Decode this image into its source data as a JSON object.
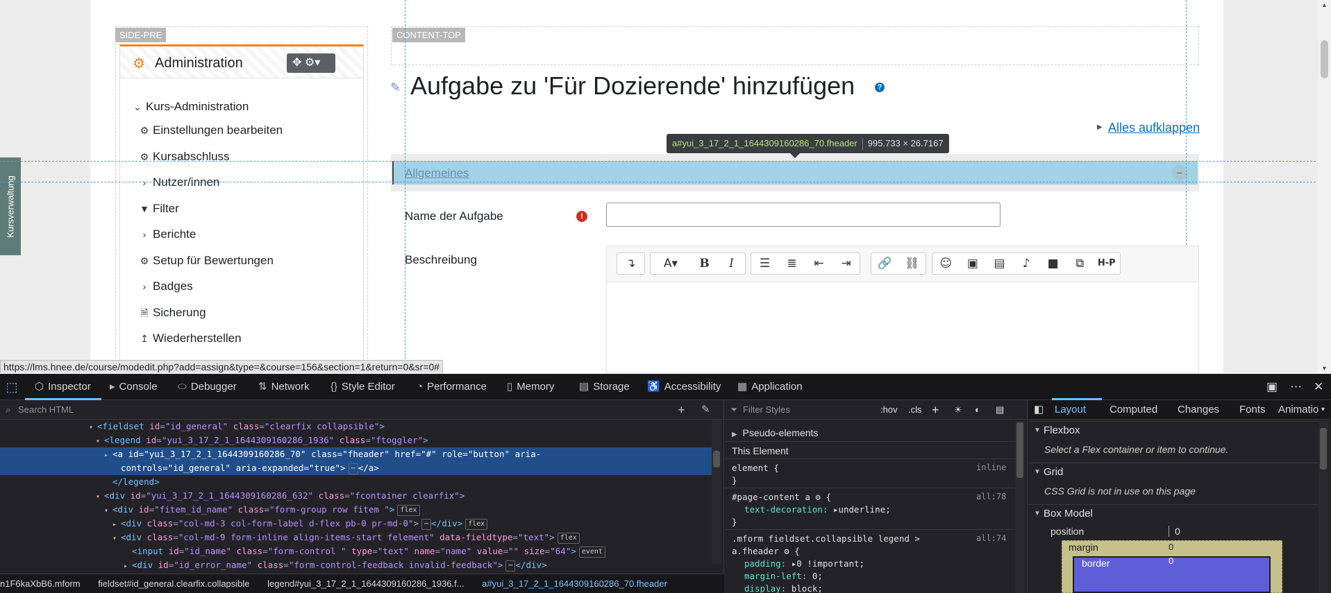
{
  "page": {
    "side_pre_label": "SIDE-PRE",
    "content_top_label": "CONTENT-TOP",
    "sidebar_tab": "Kursverwaltung",
    "block_title": "Administration",
    "nav": [
      {
        "label": "Kurs-Administration",
        "icon": "chevron-down-icon"
      },
      {
        "label": "Einstellungen bearbeiten",
        "icon": "gear-icon"
      },
      {
        "label": "Kursabschluss",
        "icon": "gear-icon"
      },
      {
        "label": "Nutzer/innen",
        "icon": "chevron-right-icon"
      },
      {
        "label": "Filter",
        "icon": "filter-icon"
      },
      {
        "label": "Berichte",
        "icon": "chevron-right-icon"
      },
      {
        "label": "Setup für Bewertungen",
        "icon": "gear-icon"
      },
      {
        "label": "Badges",
        "icon": "chevron-right-icon"
      },
      {
        "label": "Sicherung",
        "icon": "file-icon"
      },
      {
        "label": "Wiederherstellen",
        "icon": "upload-icon"
      }
    ],
    "title": "Aufgabe zu 'Für Dozierende' hinzufügen",
    "expand_all": "Alles aufklappen",
    "legend": "Allgemeines",
    "field_name_label": "Name der Aufgabe",
    "field_name_value": "",
    "field_desc_label": "Beschreibung",
    "tooltip_selector": "a#yui_3_17_2_1_1644309160286_70.fheader",
    "tooltip_size": "995.733 × 26.7167",
    "status_url": "https://lms.hnee.de/course/modedit.php?add=assign&type=&course=156&section=1&return=0&sr=0#"
  },
  "editor_toolbar": {
    "icons": [
      "collapse-icon",
      "font-size-icon",
      "bold-icon",
      "italic-icon",
      "bullet-list-icon",
      "numbered-list-icon",
      "outdent-icon",
      "indent-icon",
      "link-icon",
      "unlink-icon",
      "emoji-icon",
      "image-icon",
      "media-icon",
      "record-audio-icon",
      "record-video-icon",
      "manage-files-icon",
      "h5p-icon"
    ],
    "bold": "B",
    "italic": "I",
    "h5p": "H-P"
  },
  "devtools": {
    "tabs": [
      "Inspector",
      "Console",
      "Debugger",
      "Network",
      "Style Editor",
      "Performance",
      "Memory",
      "Storage",
      "Accessibility",
      "Application"
    ],
    "search_placeholder": "Search HTML",
    "filter_placeholder": "Filter Styles",
    "hov": ":hov",
    ".cls": ".cls",
    "html_lines": [
      {
        "indent": 140,
        "tw": "▾",
        "html": "<span class='tag'>&lt;fieldset</span> <span class='attr'>id</span>=<span class='val'>\"id_general\"</span> <span class='attr'>class</span>=<span class='val'>\"clearfix collapsible\"</span><span class='tag'>&gt;</span>"
      },
      {
        "indent": 150,
        "tw": "▾",
        "html": "<span class='tag'>&lt;legend</span> <span class='attr'>id</span>=<span class='val'>\"yui_3_17_2_1_1644309160286_1936\"</span> <span class='attr'>class</span>=<span class='val'>\"ftoggler\"</span><span class='tag'>&gt;</span>"
      },
      {
        "indent": 162,
        "tw": "▸",
        "sel": true,
        "html": "<span class='tag'>&lt;a</span> <span class='attr'>id</span>=<span class='val'>\"yui_3_17_2_1_1644309160286_70\"</span> <span class='attr'>class</span>=<span class='val'>\"fheader\"</span> <span class='attr'>href</span>=<span class='val'>\"#\"</span> <span class='attr'>role</span>=<span class='val'>\"button\"</span> <span class='attr'>aria-</span>"
      },
      {
        "indent": 174,
        "tw": "",
        "sel": true,
        "html": "<span class='attr'>controls</span>=<span class='val'>\"id_general\"</span> <span class='attr'>aria-expanded</span>=<span class='val'>\"true\"</span><span class='tag'>&gt;</span><span class='badge'>⋯</span><span class='tag'>&lt;/a&gt;</span>"
      },
      {
        "indent": 162,
        "tw": "",
        "html": "<span class='tag'>&lt;/legend&gt;</span>"
      },
      {
        "indent": 150,
        "tw": "▾",
        "html": "<span class='tag'>&lt;div</span> <span class='attr'>id</span>=<span class='val'>\"yui_3_17_2_1_1644309160286_632\"</span> <span class='attr'>class</span>=<span class='val'>\"fcontainer clearfix\"</span><span class='tag'>&gt;</span>"
      },
      {
        "indent": 162,
        "tw": "▾",
        "html": "<span class='tag'>&lt;div</span> <span class='attr'>id</span>=<span class='val'>\"fitem_id_name\"</span> <span class='attr'>class</span>=<span class='val'>\"form-group row fitem \"</span><span class='tag'>&gt;</span><span class='badge'>flex</span>"
      },
      {
        "indent": 174,
        "tw": "▸",
        "html": "<span class='tag'>&lt;div</span> <span class='attr'>class</span>=<span class='val'>\"col-md-3 col-form-label d-flex pb-0 pr-md-0\"</span><span class='tag'>&gt;</span><span class='badge'>⋯</span><span class='tag'>&lt;/div&gt;</span><span class='badge'>flex</span>"
      },
      {
        "indent": 174,
        "tw": "▾",
        "html": "<span class='tag'>&lt;div</span> <span class='attr'>class</span>=<span class='val'>\"col-md-9 form-inline align-items-start felement\"</span> <span class='attr'>data-fieldtype</span>=<span class='val'>\"text\"</span><span class='tag'>&gt;</span><span class='badge'>flex</span>"
      },
      {
        "indent": 190,
        "tw": "",
        "html": "<span class='tag'>&lt;input</span> <span class='attr'>id</span>=<span class='val'>\"id_name\"</span> <span class='attr'>class</span>=<span class='val'>\"form-control \"</span> <span class='attr'>type</span>=<span class='val'>\"text\"</span> <span class='attr'>name</span>=<span class='val'>\"name\"</span> <span class='attr'>value</span>=<span class='val'>\"\"</span> <span class='attr'>size</span>=<span class='val'>\"64\"</span><span class='tag'>&gt;</span><span class='badge'>event</span>"
      },
      {
        "indent": 190,
        "tw": "▸",
        "html": "<span class='tag'>&lt;div</span> <span class='attr'>id</span>=<span class='val'>\"id_error_name\"</span> <span class='attr'>class</span>=<span class='val'>\"form-control-feedback invalid-feedback\"</span><span class='tag'>&gt;</span><span class='badge'>⋯</span><span class='tag'>&lt;/div&gt;</span>"
      }
    ],
    "breadcrumbs": [
      "n1F6kaXbB6.mform",
      "fieldset#id_general.clearfix.collapsible",
      "legend#yui_3_17_2_1_1644309160286_1936.f...",
      "a#yui_3_17_2_1_1644309160286_70.fheader"
    ],
    "rules": {
      "pseudo": "Pseudo-elements",
      "this_element": "This Element",
      "element_open": "element {",
      "element_src": "inline",
      "close": "}",
      "r1_sel": "#page-content a",
      "r1_src": "all:78",
      "r1_prop": "text-decoration:",
      "r1_val": "underline;",
      "r2_sel1": ".mform fieldset.collapsible legend >",
      "r2_sel2": "a.fheader",
      "r2_src": "all:74",
      "r2_p1": "padding:",
      "r2_v1": "0 !important;",
      "r2_p2": "margin-left:",
      "r2_v2": "0;",
      "r2_p3": "display:",
      "r2_v3": "block;"
    },
    "layout_tabs": [
      "Layout",
      "Computed",
      "Changes",
      "Fonts",
      "Animatio"
    ],
    "flexbox": "Flexbox",
    "flexbox_note": "Select a Flex container or item to continue.",
    "grid": "Grid",
    "grid_note": "CSS Grid is not in use on this page",
    "box_model": "Box Model",
    "position_label": "position",
    "position_val": "0",
    "margin_label": "margin",
    "margin_val": "0",
    "border_label": "border",
    "border_val": "0"
  }
}
